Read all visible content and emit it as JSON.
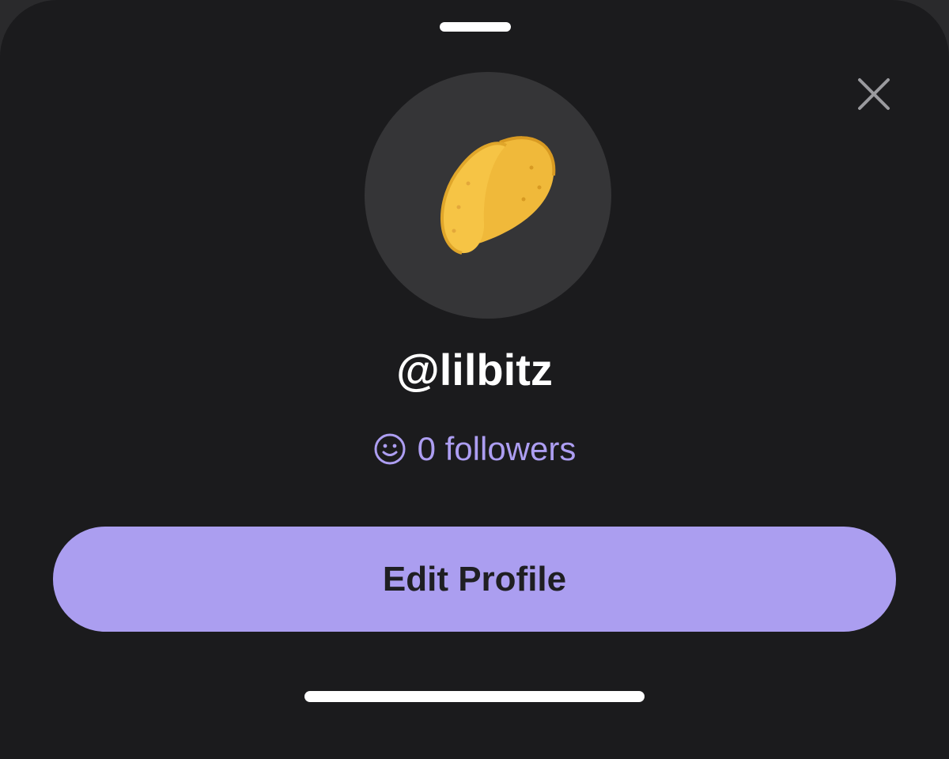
{
  "profile": {
    "username": "@lilbitz",
    "followers_label": "0 followers",
    "avatar_emoji": "taco"
  },
  "actions": {
    "edit_profile_label": "Edit Profile"
  },
  "icons": {
    "close": "close-icon",
    "followers": "smiley-icon",
    "avatar": "taco-icon"
  },
  "colors": {
    "sheet_background": "#1b1b1d",
    "accent": "#ab9ef0",
    "followers_text": "#ad9ef2",
    "avatar_background": "#353537"
  }
}
